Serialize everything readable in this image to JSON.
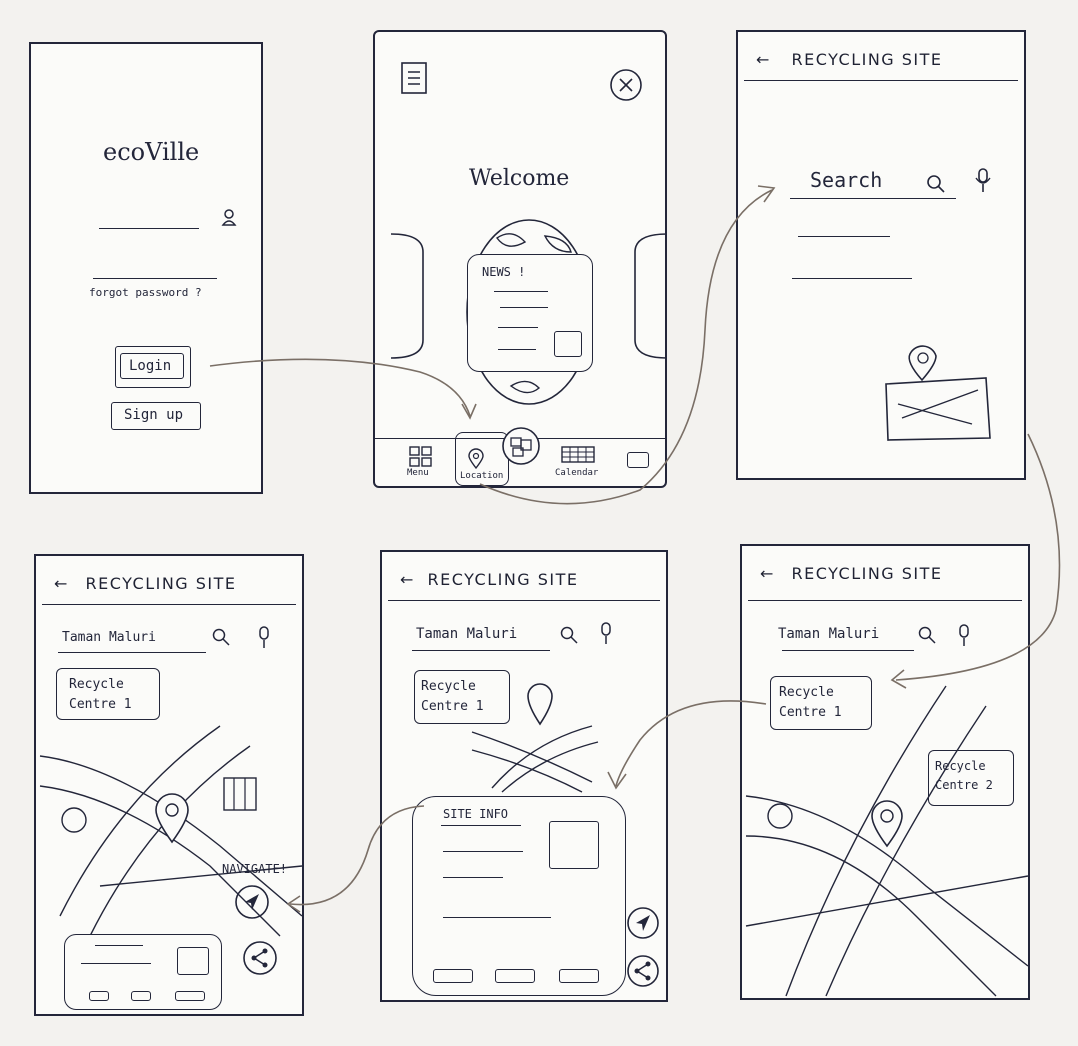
{
  "login": {
    "app_name": "ecoVille",
    "forgot_password": "forgot password ?",
    "login_label": "Login",
    "signup_label": "Sign up"
  },
  "home": {
    "welcome": "Welcome",
    "news_label": "NEWS !",
    "nav": {
      "menu": "Menu",
      "location": "Location",
      "calendar": "Calendar"
    }
  },
  "search_screen": {
    "header": "RECYCLING SITE",
    "search_placeholder": "Search"
  },
  "map_navigate": {
    "header": "RECYCLING SITE",
    "query": "Taman Maluri",
    "marker1": "Recycle\nCentre 1",
    "navigate": "NAVIGATE!"
  },
  "map_info": {
    "header": "RECYCLING SITE",
    "query": "Taman Maluri",
    "marker1": "Recycle\nCentre 1",
    "site_info": "SITE INFO"
  },
  "map_results": {
    "header": "RECYCLING SITE",
    "query": "Taman Maluri",
    "marker1": "Recycle\nCentre 1",
    "marker2": "Recycle\nCentre 2"
  },
  "colors": {
    "ink": "#23263a",
    "flow_arrow": "#7a6f66",
    "paper": "#f3f2ef"
  }
}
